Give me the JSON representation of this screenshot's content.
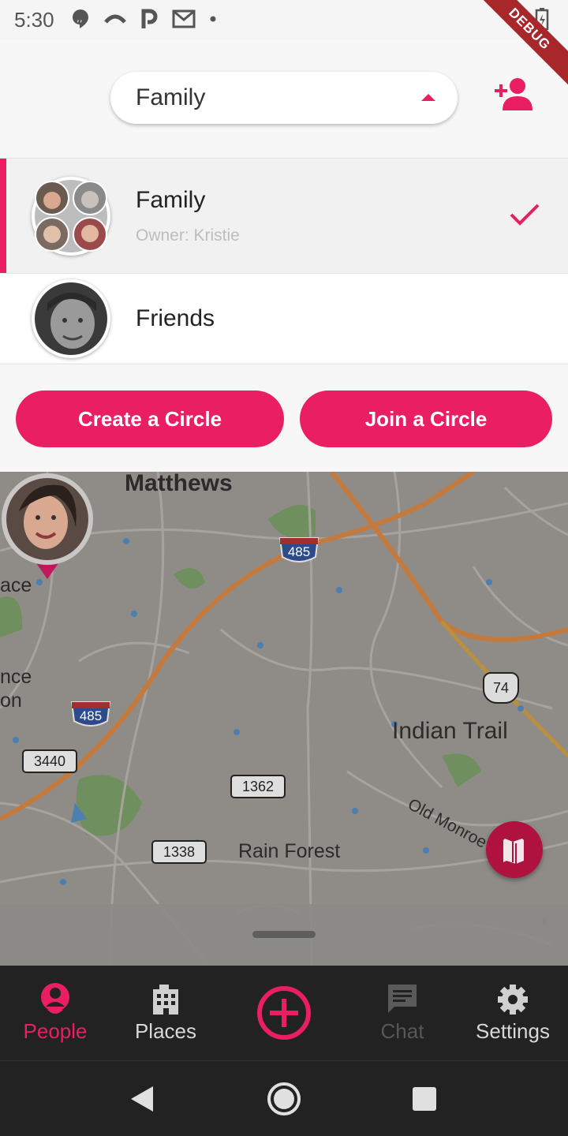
{
  "status_bar": {
    "time": "5:30"
  },
  "debug_ribbon": "DEBUG",
  "header": {
    "selected_circle": "Family"
  },
  "circles": [
    {
      "name": "Family",
      "owner": "Owner: Kristie",
      "selected": true
    },
    {
      "name": "Friends",
      "selected": false
    }
  ],
  "actions": {
    "create": "Create a Circle",
    "join": "Join a Circle"
  },
  "map": {
    "labels": {
      "matthews": "Matthews",
      "indian_trail": "Indian Trail",
      "rain_forest": "Rain Forest",
      "old_monroe": "Old Monroe",
      "ace": "ace",
      "nce": "nce",
      "on": "on"
    },
    "shields": {
      "i485_top": "485",
      "i485_left": "485",
      "us74": "74",
      "r3440": "3440",
      "r1362": "1362",
      "r1338": "1338"
    }
  },
  "nav": {
    "people": "People",
    "places": "Places",
    "chat": "Chat",
    "settings": "Settings",
    "active": "People"
  },
  "colors": {
    "accent": "#e91e63",
    "map_fab": "#b0123f",
    "nav_bg": "#222222"
  }
}
